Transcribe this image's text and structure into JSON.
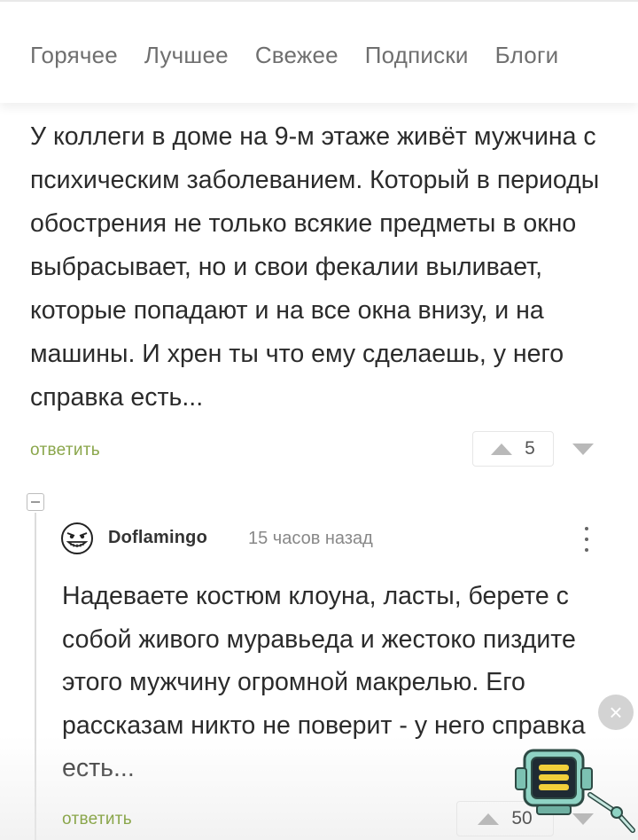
{
  "nav": {
    "tabs": [
      "Горячее",
      "Лучшее",
      "Свежее",
      "Подписки",
      "Блоги"
    ]
  },
  "post": {
    "text": "У коллеги в доме на 9-м этаже живёт мужчина с психическим заболеванием. Который в периоды обострения не только всякие предметы в окно выбрасывает, но и свои фекалии выливает, которые попадают и на все окна внизу, и на машины. И хрен ты что ему сделаешь, у него справка есть...",
    "reply_label": "ответить",
    "votes": "5"
  },
  "reply": {
    "username": "Doflamingo",
    "time": "15 часов назад",
    "text": "Надеваете костюм клоуна, ласты, берете с собой живого муравьеда и жестоко пиздите этого мужчину огромной макрелью. Его рассказам никто не поверит - у него справка есть...",
    "reply_label": "ответить",
    "votes": "50"
  },
  "overlay": {
    "close_symbol": "×"
  },
  "colors": {
    "accent_green": "#8aa64b",
    "text": "#2b2b2b",
    "muted": "#6f6f6f"
  },
  "icons": [
    "arrow-up-icon",
    "arrow-down-icon",
    "collapse-icon",
    "avatar-icon",
    "more-vertical-icon",
    "close-icon",
    "mascot-icon"
  ]
}
